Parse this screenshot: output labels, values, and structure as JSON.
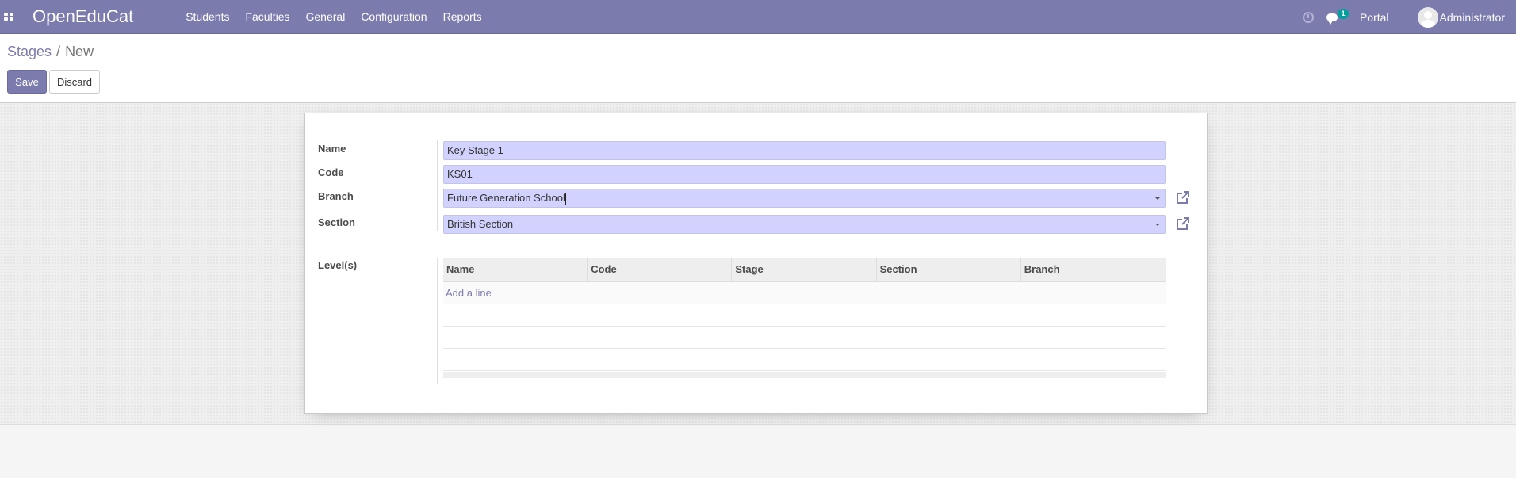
{
  "navbar": {
    "brand": "OpenEduCat",
    "menu": [
      "Students",
      "Faculties",
      "General",
      "Configuration",
      "Reports"
    ],
    "chat_badge": "1",
    "portal": "Portal",
    "user": "Administrator",
    "color": "#7c7bad"
  },
  "breadcrumb": {
    "parent": "Stages",
    "separator": "/",
    "current": "New"
  },
  "buttons": {
    "save": "Save",
    "discard": "Discard"
  },
  "form": {
    "name": {
      "label": "Name",
      "value": "Key Stage 1"
    },
    "code": {
      "label": "Code",
      "value": "KS01"
    },
    "branch": {
      "label": "Branch",
      "value": "Future Generation School"
    },
    "section": {
      "label": "Section",
      "value": "British Section"
    },
    "levels": {
      "label": "Level(s)",
      "columns": [
        "Name",
        "Code",
        "Stage",
        "Section",
        "Branch"
      ],
      "add_line": "Add a line"
    }
  },
  "icons": {
    "apps": "apps-grid-icon",
    "activity": "clock-icon",
    "messages": "chat-icon",
    "external": "external-link-icon",
    "dropdown": "caret-down-icon"
  }
}
